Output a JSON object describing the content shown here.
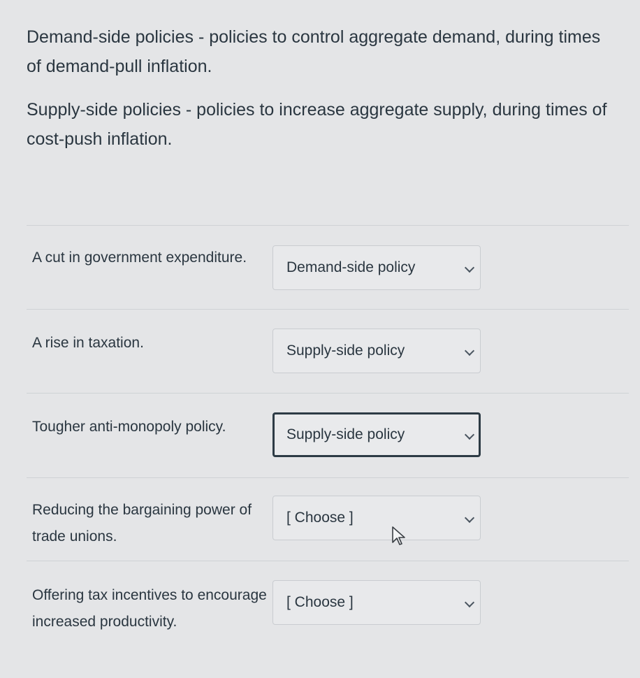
{
  "intro": {
    "demand_text": "Demand-side policies - policies to control aggregate demand, during times of demand-pull inflation.",
    "supply_text": "Supply-side policies - policies to increase aggregate supply, during times of cost-push inflation."
  },
  "questions": [
    {
      "label": "A cut in government expenditure.",
      "selected": "Demand-side policy"
    },
    {
      "label": "A rise in taxation.",
      "selected": "Supply-side policy"
    },
    {
      "label": "Tougher anti-monopoly policy.",
      "selected": "Supply-side policy"
    },
    {
      "label": "Reducing the bargaining power of trade unions.",
      "selected": "[ Choose ]"
    },
    {
      "label": "Offering tax incentives to encourage increased productivity.",
      "selected": "[ Choose ]"
    }
  ],
  "colors": {
    "background": "#e4e5e7",
    "text": "#2a3640",
    "focus_border": "#2d3b45"
  },
  "icons": {
    "dropdown": "chevron-down-icon",
    "pointer": "mouse-cursor-icon"
  }
}
